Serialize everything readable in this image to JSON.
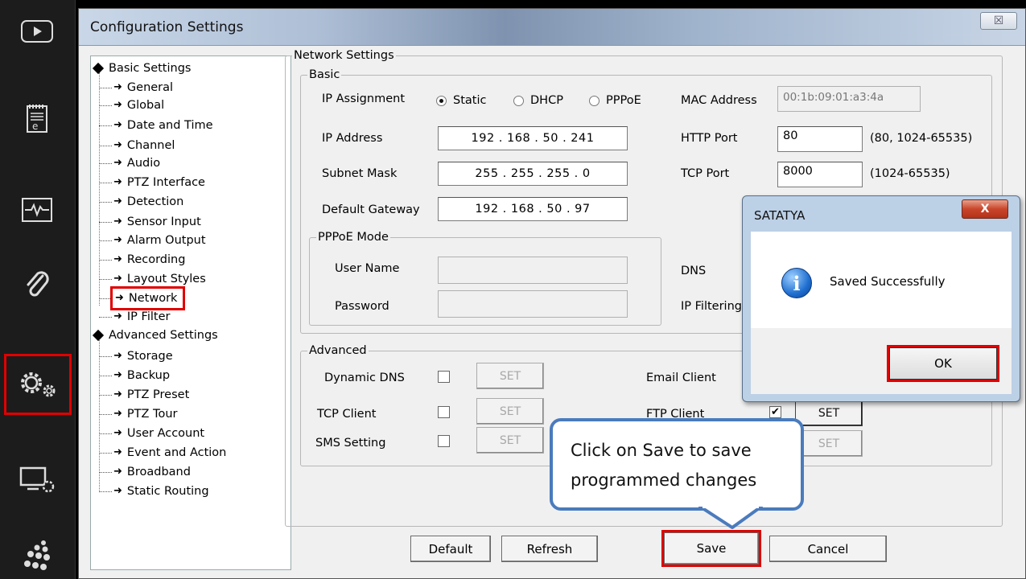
{
  "toolbar": {
    "items": [
      "play-icon",
      "event-log-icon",
      "health-monitor-icon",
      "attachment-icon",
      "settings-gears-icon",
      "display-settings-icon",
      "apps-grid-icon"
    ],
    "highlight_color": "#e00000"
  },
  "window": {
    "title": "Configuration Settings",
    "close_label": "☒"
  },
  "tree": {
    "roots": [
      {
        "label": "Basic Settings",
        "children": [
          "General",
          "Global",
          "Date and Time",
          "Channel",
          "Audio",
          "PTZ Interface",
          "Detection",
          "Sensor Input",
          "Alarm Output",
          "Recording",
          "Layout Styles",
          "Network",
          "IP Filter"
        ]
      },
      {
        "label": "Advanced Settings",
        "children": [
          "Storage",
          "Backup",
          "PTZ Preset",
          "PTZ Tour",
          "User Account",
          "Event and Action",
          "Broadband",
          "Static Routing"
        ]
      }
    ],
    "selected": "Network"
  },
  "network": {
    "group_title": "Network Settings",
    "basic_title": "Basic",
    "ip_assignment_label": "IP Assignment",
    "radio_static": "Static",
    "radio_dhcp": "DHCP",
    "radio_pppoe": "PPPoE",
    "selected_mode": "Static",
    "mac_label": "MAC Address",
    "mac_value": "00:1b:09:01:a3:4a",
    "ip_label": "IP Address",
    "ip_value": "192  .  168  .   50   .  241",
    "subnet_label": "Subnet Mask",
    "subnet_value": "255  .  255  .  255  .    0",
    "gateway_label": "Default Gateway",
    "gateway_value": "192  .  168  .   50   .   97",
    "http_label": "HTTP Port",
    "http_value": "80",
    "http_range": "(80, 1024-65535)",
    "tcp_label": "TCP Port",
    "tcp_value": "8000",
    "tcp_range": "(1024-65535)",
    "pppoe_title": "PPPoE Mode",
    "username_label": "User Name",
    "password_label": "Password",
    "dns_label": "DNS",
    "ipfilter_label": "IP Filtering"
  },
  "advanced": {
    "title": "Advanced",
    "ddns_label": "Dynamic DNS",
    "tcpclient_label": "TCP Client",
    "sms_label": "SMS Setting",
    "email_label": "Email Client",
    "ftp_label": "FTP Client",
    "set_label": "SET"
  },
  "buttons": {
    "default": "Default",
    "refresh": "Refresh",
    "save": "Save",
    "cancel": "Cancel"
  },
  "msgbox": {
    "title": "SATATYA",
    "close": "X",
    "message": "Saved Successfully",
    "icon": "info-icon",
    "ok": "OK"
  },
  "callout": {
    "line1": "Click on Save to save",
    "line2": "programmed changes",
    "border_color": "#4a7bbd"
  }
}
